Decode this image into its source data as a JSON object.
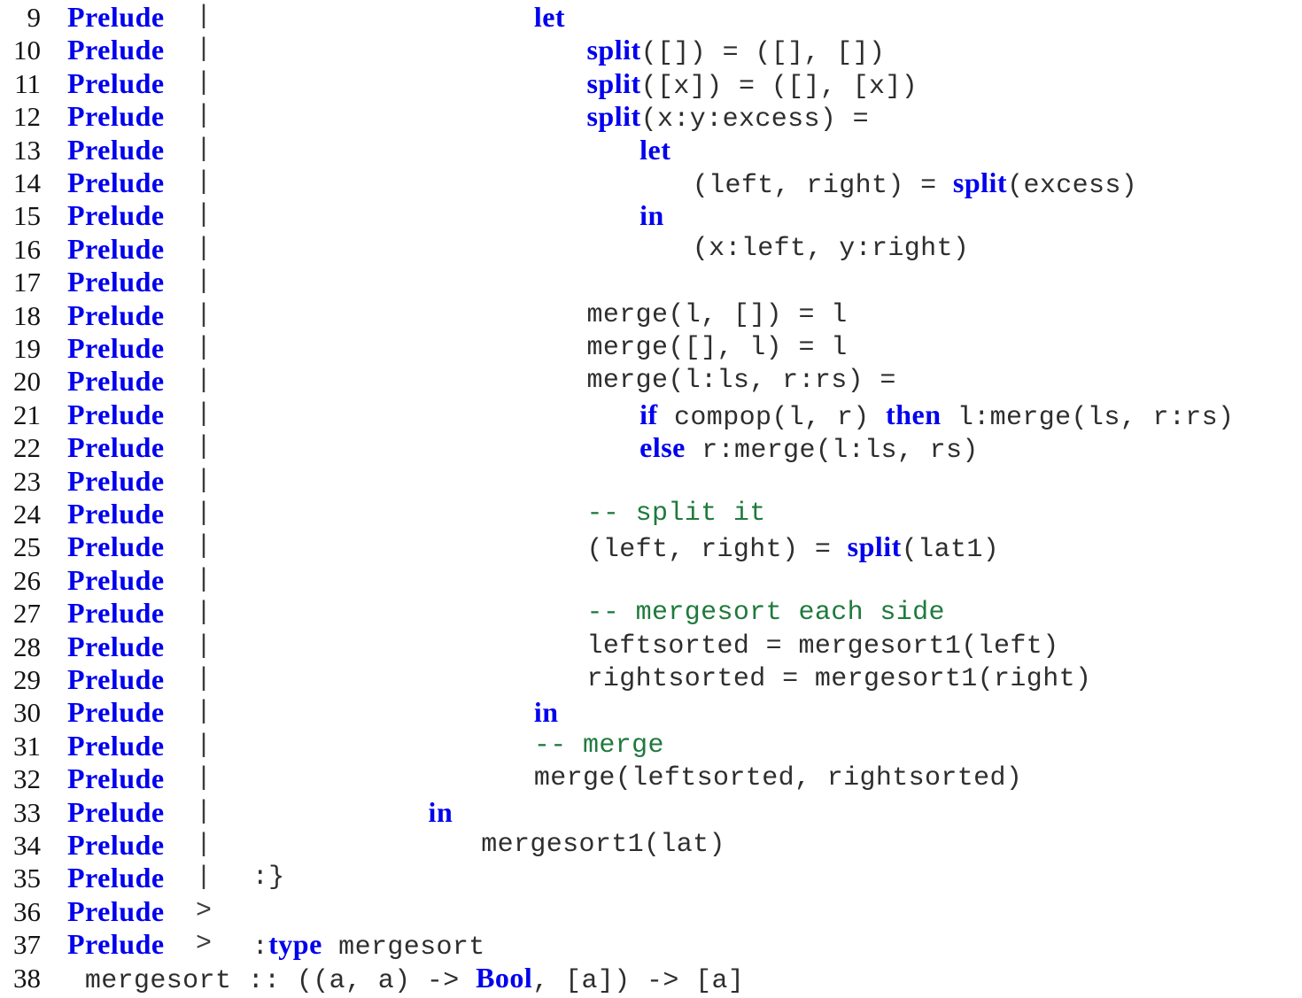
{
  "session": {
    "prompt_label": "Prelude",
    "separator_continuation": "|",
    "separator_prompt": ">",
    "colors": {
      "keyword_blue": "#0000ee",
      "comment_green": "#1f7a3c",
      "code_gray": "#2e2e2e",
      "lineno_black": "#131313",
      "background": "#ffffff"
    }
  },
  "lines": [
    {
      "no": "9",
      "prompt": "Prelude",
      "sep": "|",
      "indent": 18,
      "tokens": [
        {
          "t": "let",
          "k": "kw"
        }
      ]
    },
    {
      "no": "10",
      "prompt": "Prelude",
      "sep": "|",
      "indent": 21,
      "tokens": [
        {
          "t": "split",
          "k": "kw"
        },
        {
          "t": "([]) = ([], [])",
          "k": "code"
        }
      ]
    },
    {
      "no": "11",
      "prompt": "Prelude",
      "sep": "|",
      "indent": 21,
      "tokens": [
        {
          "t": "split",
          "k": "kw"
        },
        {
          "t": "([x]) = ([], [x])",
          "k": "code"
        }
      ]
    },
    {
      "no": "12",
      "prompt": "Prelude",
      "sep": "|",
      "indent": 21,
      "tokens": [
        {
          "t": "split",
          "k": "kw"
        },
        {
          "t": "(x:y:excess) =",
          "k": "code"
        }
      ]
    },
    {
      "no": "13",
      "prompt": "Prelude",
      "sep": "|",
      "indent": 24,
      "tokens": [
        {
          "t": "let",
          "k": "kw"
        }
      ]
    },
    {
      "no": "14",
      "prompt": "Prelude",
      "sep": "|",
      "indent": 27,
      "tokens": [
        {
          "t": "(left, right) = ",
          "k": "code"
        },
        {
          "t": "split",
          "k": "kw"
        },
        {
          "t": "(excess)",
          "k": "code"
        }
      ]
    },
    {
      "no": "15",
      "prompt": "Prelude",
      "sep": "|",
      "indent": 24,
      "tokens": [
        {
          "t": "in",
          "k": "kw"
        }
      ]
    },
    {
      "no": "16",
      "prompt": "Prelude",
      "sep": "|",
      "indent": 27,
      "tokens": [
        {
          "t": "(x:left, y:right)",
          "k": "code"
        }
      ]
    },
    {
      "no": "17",
      "prompt": "Prelude",
      "sep": "|",
      "indent": 0,
      "tokens": []
    },
    {
      "no": "18",
      "prompt": "Prelude",
      "sep": "|",
      "indent": 21,
      "tokens": [
        {
          "t": "merge(l, []) = l",
          "k": "code"
        }
      ]
    },
    {
      "no": "19",
      "prompt": "Prelude",
      "sep": "|",
      "indent": 21,
      "tokens": [
        {
          "t": "merge([], l) = l",
          "k": "code"
        }
      ]
    },
    {
      "no": "20",
      "prompt": "Prelude",
      "sep": "|",
      "indent": 21,
      "tokens": [
        {
          "t": "merge(l:ls, r:rs) =",
          "k": "code"
        }
      ]
    },
    {
      "no": "21",
      "prompt": "Prelude",
      "sep": "|",
      "indent": 24,
      "tokens": [
        {
          "t": "if",
          "k": "kw"
        },
        {
          "t": " compop(l, r) ",
          "k": "code"
        },
        {
          "t": "then",
          "k": "kw"
        },
        {
          "t": " l:merge(ls, r:rs)",
          "k": "code"
        }
      ]
    },
    {
      "no": "22",
      "prompt": "Prelude",
      "sep": "|",
      "indent": 24,
      "tokens": [
        {
          "t": "else",
          "k": "kw"
        },
        {
          "t": " r:merge(l:ls, rs)",
          "k": "code"
        }
      ]
    },
    {
      "no": "23",
      "prompt": "Prelude",
      "sep": "|",
      "indent": 0,
      "tokens": []
    },
    {
      "no": "24",
      "prompt": "Prelude",
      "sep": "|",
      "indent": 21,
      "tokens": [
        {
          "t": "-- split it",
          "k": "cm"
        }
      ]
    },
    {
      "no": "25",
      "prompt": "Prelude",
      "sep": "|",
      "indent": 21,
      "tokens": [
        {
          "t": "(left, right) = ",
          "k": "code"
        },
        {
          "t": "split",
          "k": "kw"
        },
        {
          "t": "(lat1)",
          "k": "code"
        }
      ]
    },
    {
      "no": "26",
      "prompt": "Prelude",
      "sep": "|",
      "indent": 0,
      "tokens": []
    },
    {
      "no": "27",
      "prompt": "Prelude",
      "sep": "|",
      "indent": 21,
      "tokens": [
        {
          "t": "-- mergesort each side",
          "k": "cm"
        }
      ]
    },
    {
      "no": "28",
      "prompt": "Prelude",
      "sep": "|",
      "indent": 21,
      "tokens": [
        {
          "t": "leftsorted = mergesort1(left)",
          "k": "code"
        }
      ]
    },
    {
      "no": "29",
      "prompt": "Prelude",
      "sep": "|",
      "indent": 21,
      "tokens": [
        {
          "t": "rightsorted = mergesort1(right)",
          "k": "code"
        }
      ]
    },
    {
      "no": "30",
      "prompt": "Prelude",
      "sep": "|",
      "indent": 18,
      "tokens": [
        {
          "t": "in",
          "k": "kw"
        }
      ]
    },
    {
      "no": "31",
      "prompt": "Prelude",
      "sep": "|",
      "indent": 18,
      "tokens": [
        {
          "t": "-- merge",
          "k": "cm"
        }
      ]
    },
    {
      "no": "32",
      "prompt": "Prelude",
      "sep": "|",
      "indent": 18,
      "tokens": [
        {
          "t": "merge(leftsorted, rightsorted)",
          "k": "code"
        }
      ]
    },
    {
      "no": "33",
      "prompt": "Prelude",
      "sep": "|",
      "indent": 12,
      "tokens": [
        {
          "t": "in",
          "k": "kw"
        }
      ]
    },
    {
      "no": "34",
      "prompt": "Prelude",
      "sep": "|",
      "indent": 15,
      "tokens": [
        {
          "t": "mergesort1(lat)",
          "k": "code"
        }
      ]
    },
    {
      "no": "35",
      "prompt": "Prelude",
      "sep": "|",
      "indent": 2,
      "tokens": [
        {
          "t": ":}",
          "k": "code"
        }
      ]
    },
    {
      "no": "36",
      "prompt": "Prelude",
      "sep": ">",
      "indent": 0,
      "tokens": []
    },
    {
      "no": "37",
      "prompt": "Prelude",
      "sep": ">",
      "indent": 2,
      "tokens": [
        {
          "t": ":",
          "k": "code"
        },
        {
          "t": "type",
          "k": "kw"
        },
        {
          "t": " mergesort",
          "k": "code"
        }
      ]
    },
    {
      "no": "38",
      "prompt": "",
      "sep": "",
      "indent": 1,
      "tokens": [
        {
          "t": "mergesort :: ((a, a) -> ",
          "k": "code"
        },
        {
          "t": "Bool",
          "k": "kw"
        },
        {
          "t": ", [a]) -> [a]",
          "k": "code"
        }
      ]
    }
  ]
}
